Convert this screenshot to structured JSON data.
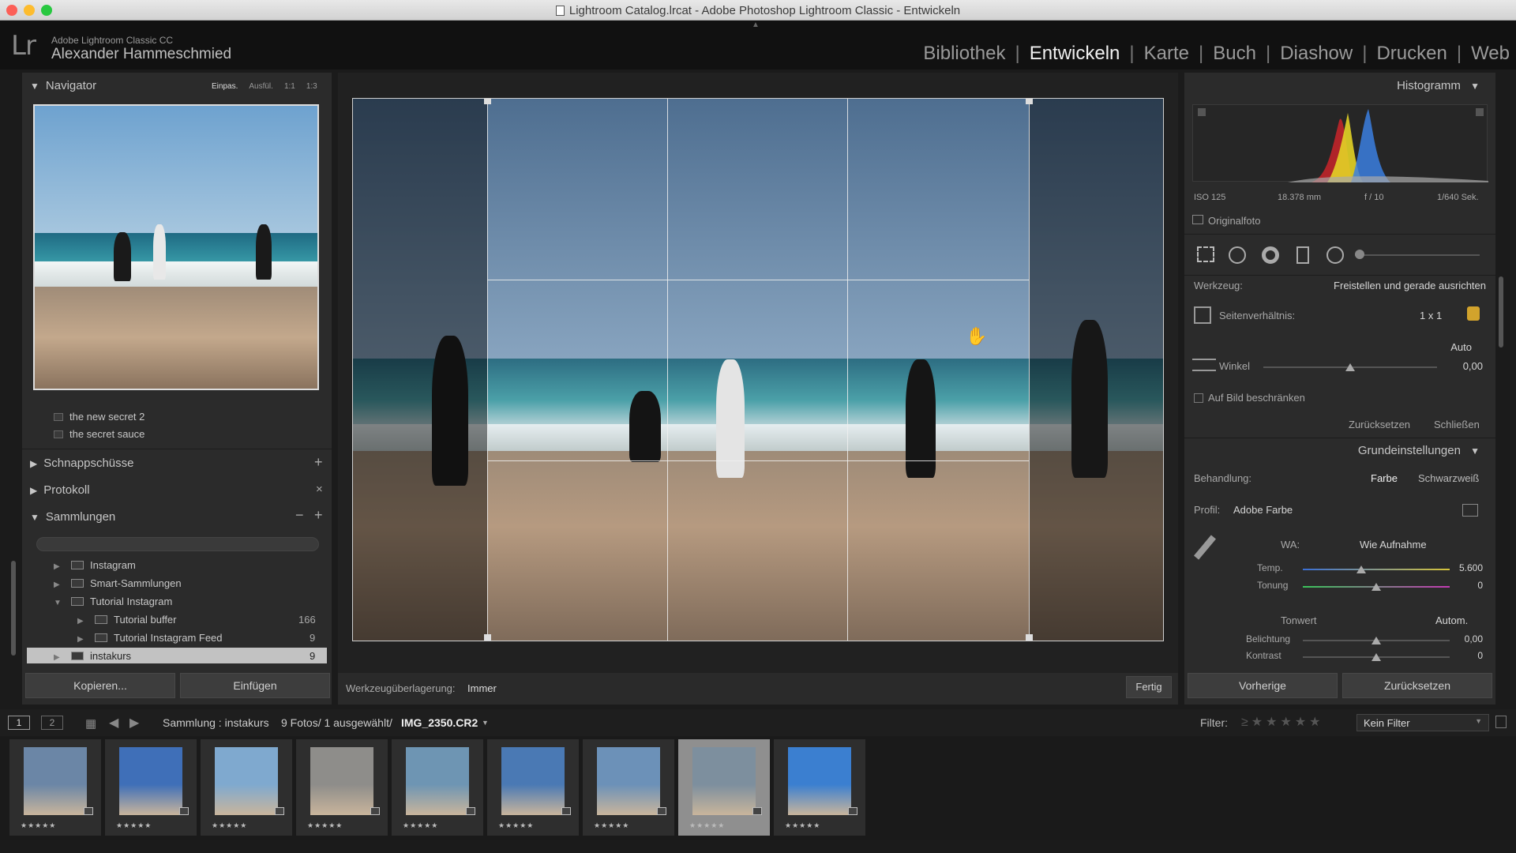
{
  "window": {
    "title": "Lightroom Catalog.lrcat - Adobe Photoshop Lightroom Classic - Entwickeln"
  },
  "header": {
    "logo": "Lr",
    "app_name": "Adobe Lightroom Classic CC",
    "user_name": "Alexander Hammeschmied",
    "modules": [
      "Bibliothek",
      "Entwickeln",
      "Karte",
      "Buch",
      "Diashow",
      "Drucken",
      "Web"
    ],
    "active_module": "Entwickeln"
  },
  "left": {
    "navigator": {
      "title": "Navigator",
      "zoom_options": [
        "Einpas.",
        "Ausfül.",
        "1:1",
        "1:3"
      ]
    },
    "presets": [
      "the new secret 2",
      "the secret sauce"
    ],
    "snapshots": "Schnappschüsse",
    "history": "Protokoll",
    "collections": {
      "title": "Sammlungen",
      "items": [
        {
          "label": "Instagram",
          "count": ""
        },
        {
          "label": "Smart-Sammlungen",
          "count": ""
        },
        {
          "label": "Tutorial Instagram",
          "count": ""
        },
        {
          "label": "Tutorial buffer",
          "count": "166"
        },
        {
          "label": "Tutorial Instagram Feed",
          "count": "9"
        },
        {
          "label": "instakurs",
          "count": "9"
        }
      ]
    },
    "copy_button": "Kopieren...",
    "paste_button": "Einfügen"
  },
  "toolbar": {
    "overlay_label": "Werkzeugüberlagerung:",
    "overlay_value": "Immer",
    "done_button": "Fertig"
  },
  "right": {
    "histogram": {
      "title": "Histogramm",
      "iso": "ISO 125",
      "focal": "18.378 mm",
      "aperture": "f / 10",
      "shutter": "1/640 Sek.",
      "original_photo": "Originalfoto"
    },
    "crop": {
      "tool_label": "Werkzeug:",
      "tool_value": "Freistellen und gerade ausrichten",
      "aspect_label": "Seitenverhältnis:",
      "aspect_value": "1 x 1",
      "auto_label": "Auto",
      "angle_label": "Winkel",
      "angle_value": "0,00",
      "angle_level": 0.5,
      "constrain_label": "Auf Bild beschränken",
      "reset": "Zurücksetzen",
      "close": "Schließen"
    },
    "basic": {
      "title": "Grundeinstellungen",
      "treatment_label": "Behandlung:",
      "treatment_color": "Farbe",
      "treatment_bw": "Schwarzweiß",
      "profile_label": "Profil:",
      "profile_value": "Adobe Farbe",
      "wb_label": "WA:",
      "wb_value": "Wie Aufnahme",
      "temp_label": "Temp.",
      "temp_value": "5.600",
      "temp_level": 0.4,
      "tint_label": "Tonung",
      "tint_value": "0",
      "tint_level": 0.5,
      "tone_label": "Tonwert",
      "tone_auto": "Autom.",
      "exposure_label": "Belichtung",
      "exposure_value": "0,00",
      "exposure_level": 0.5,
      "contrast_label": "Kontrast",
      "contrast_value": "0",
      "contrast_level": 0.5
    },
    "previous_button": "Vorherige",
    "reset_button": "Zurücksetzen"
  },
  "filmstrip_bar": {
    "view1": "1",
    "view2": "2",
    "source": "Sammlung : instakurs",
    "info": "9 Fotos/ 1 ausgewählt/",
    "filename": "IMG_2350.CR2",
    "filter_label": "Filter:",
    "filter_value": "Kein Filter"
  },
  "filmstrip": {
    "thumbs": [
      {
        "stars": "★★★★★",
        "color": "#6b86a6"
      },
      {
        "stars": "★★★★★",
        "color": "#3f6fb8"
      },
      {
        "stars": "★★★★★",
        "color": "#7fa9cf"
      },
      {
        "stars": "★★★★★",
        "color": "#8e8d8a"
      },
      {
        "stars": "★★★★★",
        "color": "#6e95b3"
      },
      {
        "stars": "★★★★★",
        "color": "#4a79b4"
      },
      {
        "stars": "★★★★★",
        "color": "#6c91b8"
      },
      {
        "stars": "★★★★★",
        "color": "#7d8f9e"
      },
      {
        "stars": "★★★★★",
        "color": "#3b7fd0"
      }
    ],
    "selected_index": 7
  }
}
